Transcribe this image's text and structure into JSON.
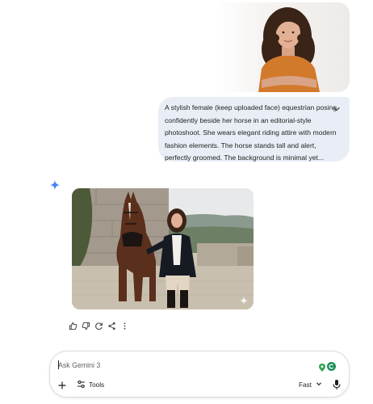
{
  "conversation": {
    "user_message": {
      "uploaded_image_alt": "",
      "prompt_lines": [
        "A stylish female (keep uploaded face) equestrian posing",
        "confidently beside her horse in an editorial-style",
        "photoshoot. She wears elegant riding attire with modern",
        "fashion elements. The horse stands tall and alert,",
        "perfectly groomed. The background is minimal yet..."
      ]
    },
    "response": {
      "actions": [
        "thumbs-up-icon",
        "thumbs-down-icon",
        "regenerate-icon",
        "share-icon",
        "more-vert-icon"
      ]
    }
  },
  "composer": {
    "placeholder": "Ask Gemini 3",
    "tools_label": "Tools",
    "mode_label": "Fast"
  },
  "colors": {
    "bubble_bg": "#e9eef6",
    "gemini_blue": "#4285f4",
    "icon_gray": "#444746",
    "pin_green": "#34a853",
    "ext_teal": "#1e8e5a"
  }
}
